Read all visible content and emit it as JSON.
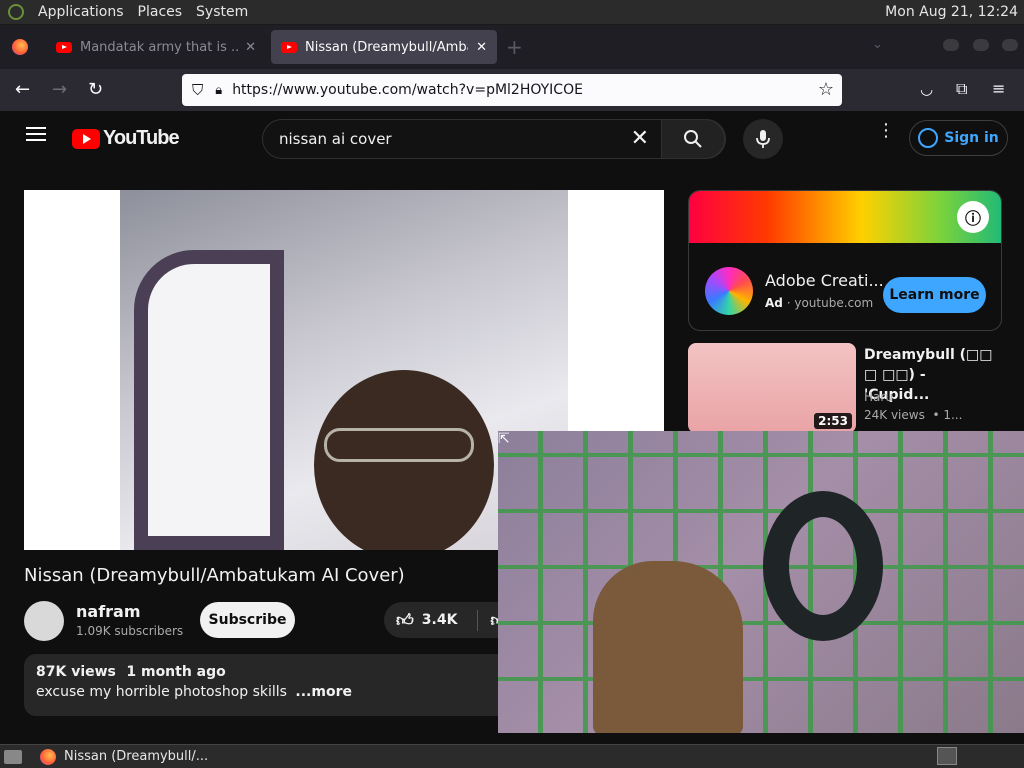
{
  "panel": {
    "menu": [
      "Applications",
      "Places",
      "System"
    ],
    "clock": "Mon Aug 21, 12:24"
  },
  "browser": {
    "tabs": [
      {
        "title": "Mandatak army that is ...",
        "active": false
      },
      {
        "title": "Nissan (Dreamybull/Ambatu",
        "active": true
      }
    ],
    "url": "https://www.youtube.com/watch?v=pMl2HOYICOE"
  },
  "youtube": {
    "logo_text": "YouTube",
    "search_query": "nissan ai cover",
    "sign_in": "Sign in",
    "video": {
      "title": "Nissan (Dreamybull/Ambatukam AI Cover)",
      "channel": "nafram",
      "subscribers": "1.09K subscribers",
      "subscribe_label": "Subscribe",
      "likes": "3.4K",
      "views": "87K views",
      "age": "1 month ago",
      "description": "excuse my horrible photoshop skills",
      "more_label": "...more"
    },
    "ad": {
      "title": "Adobe Creati...",
      "badge": "Ad",
      "domain": "youtube.com",
      "cta": "Learn more"
    },
    "recommendation": {
      "title_line1": "Dreamybull (□□",
      "title_line2": "□ □□) - 'Cupid...",
      "channel": "Haru",
      "meta": "24K views  • 1...",
      "duration": "2:53"
    }
  },
  "taskbar": {
    "window_title": "Nissan (Dreamybull/..."
  },
  "colors": {
    "youtube_red": "#ff0000",
    "link_blue": "#3ea6ff",
    "page_bg": "#0f0f0f"
  }
}
